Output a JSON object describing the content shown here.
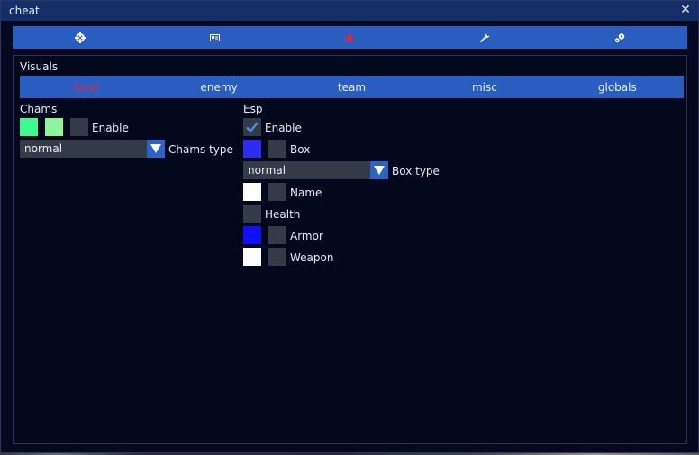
{
  "window": {
    "title": "cheat",
    "close_glyph": "✕"
  },
  "main_tabs": [
    {
      "icon": "crosshair-icon",
      "color": "#ffffff"
    },
    {
      "icon": "id-card-icon",
      "color": "#ffffff"
    },
    {
      "icon": "bug-icon",
      "color": "#e0253d",
      "active": true
    },
    {
      "icon": "wrench-icon",
      "color": "#ffffff"
    },
    {
      "icon": "gears-icon",
      "color": "#ffffff"
    }
  ],
  "section": {
    "title": "Visuals"
  },
  "sub_tabs": [
    {
      "label": "local",
      "active": true
    },
    {
      "label": "enemy"
    },
    {
      "label": "team"
    },
    {
      "label": "misc"
    },
    {
      "label": "globals"
    }
  ],
  "chams": {
    "title": "Chams",
    "color1": "#3dfa91",
    "color2": "#8ff59a",
    "enable_label": "Enable",
    "enable_checked": false,
    "type_value": "normal",
    "type_label": "Chams type"
  },
  "esp": {
    "title": "Esp",
    "enable_label": "Enable",
    "enable_checked": true,
    "box_color": "#2b2df0",
    "box_label": "Box",
    "box_checked": false,
    "box_type_value": "normal",
    "box_type_label": "Box type",
    "name_color": "#ffffff",
    "name_label": "Name",
    "health_label": "Health",
    "armor_color": "#0f10f6",
    "armor_label": "Armor",
    "weapon_color": "#ffffff",
    "weapon_label": "Weapon"
  },
  "colors": {
    "accent": "#2a5dc0",
    "active_tab_text": "#e0253d",
    "window_bg": "#05091f",
    "control_bg": "#333b47",
    "checkmark": "#4a90e2"
  }
}
